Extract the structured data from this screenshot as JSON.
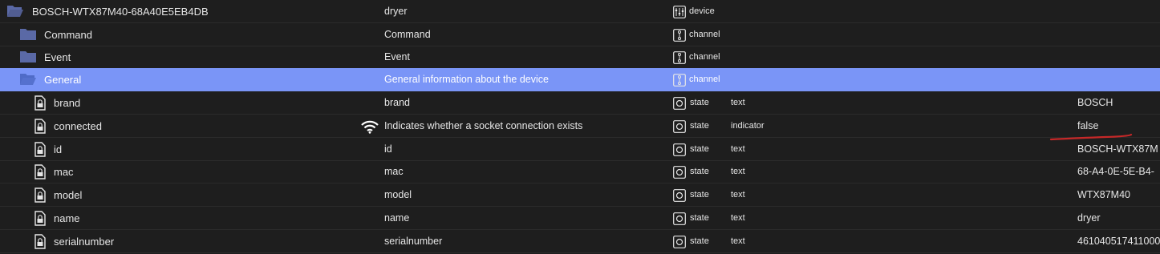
{
  "colors": {
    "background": "#1e1e1e",
    "selected_row": "#7a95f7",
    "folder": "#5a69a6",
    "annotation": "#c62828"
  },
  "rows": [
    {
      "name": "BOSCH-WTX87M40-68A40E5EB4DB",
      "description": "dryer",
      "type": "device",
      "icon": "folder-open-icon",
      "role_icon": "device-icon"
    },
    {
      "name": "Command",
      "description": "Command",
      "type": "channel",
      "icon": "folder-icon",
      "role_icon": "channel-icon"
    },
    {
      "name": "Event",
      "description": "Event",
      "type": "channel",
      "icon": "folder-icon",
      "role_icon": "channel-icon"
    },
    {
      "name": "General",
      "description": "General information about the device",
      "type": "channel",
      "icon": "folder-open-icon",
      "role_icon": "channel-icon"
    },
    {
      "name": "brand",
      "description": "brand",
      "type": "state",
      "role": "text",
      "value": "BOSCH",
      "icon": "file-lock-icon",
      "role_icon": "state-icon"
    },
    {
      "name": "connected",
      "description": "Indicates whether a socket connection exists",
      "type": "state",
      "role": "indicator",
      "value": "false",
      "icon": "file-lock-icon",
      "role_icon": "state-icon",
      "extra_icon": "wifi-icon"
    },
    {
      "name": "id",
      "description": "id",
      "type": "state",
      "role": "text",
      "value": "BOSCH-WTX87M",
      "icon": "file-lock-icon",
      "role_icon": "state-icon"
    },
    {
      "name": "mac",
      "description": "mac",
      "type": "state",
      "role": "text",
      "value": "68-A4-0E-5E-B4-",
      "icon": "file-lock-icon",
      "role_icon": "state-icon"
    },
    {
      "name": "model",
      "description": "model",
      "type": "state",
      "role": "text",
      "value": "WTX87M40",
      "icon": "file-lock-icon",
      "role_icon": "state-icon"
    },
    {
      "name": "name",
      "description": "name",
      "type": "state",
      "role": "text",
      "value": "dryer",
      "icon": "file-lock-icon",
      "role_icon": "state-icon"
    },
    {
      "name": "serialnumber",
      "description": "serialnumber",
      "type": "state",
      "role": "text",
      "value": "461040517411000",
      "icon": "file-lock-icon",
      "role_icon": "state-icon"
    }
  ]
}
